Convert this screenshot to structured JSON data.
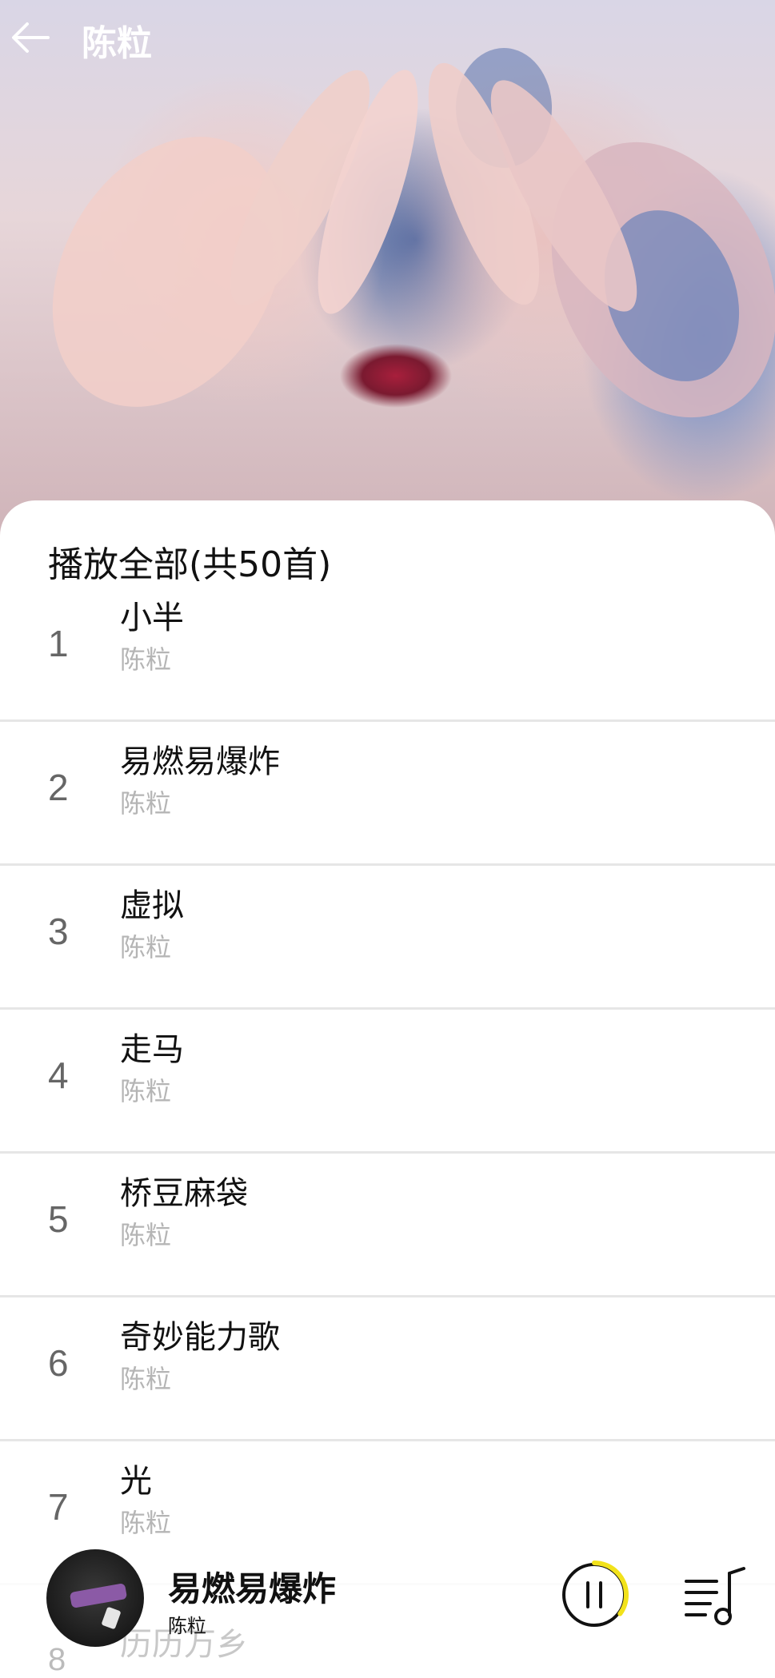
{
  "header": {
    "title": "陈粒"
  },
  "list": {
    "play_all_label": "播放全部(共50首)",
    "songs": [
      {
        "index": "1",
        "name": "小半",
        "artist": "陈粒"
      },
      {
        "index": "2",
        "name": "易燃易爆炸",
        "artist": "陈粒"
      },
      {
        "index": "3",
        "name": "虚拟",
        "artist": "陈粒"
      },
      {
        "index": "4",
        "name": "走马",
        "artist": "陈粒"
      },
      {
        "index": "5",
        "name": "桥豆麻袋",
        "artist": "陈粒"
      },
      {
        "index": "6",
        "name": "奇妙能力歌",
        "artist": "陈粒"
      },
      {
        "index": "7",
        "name": "光",
        "artist": "陈粒"
      }
    ],
    "next_song_partial": "历历万乡",
    "next_index_partial": "8"
  },
  "player": {
    "title": "易燃易爆炸",
    "artist": "陈粒",
    "progress_fraction": 0.35,
    "state": "playing"
  },
  "colors": {
    "accent_progress": "#f2e21b",
    "text_primary": "#111111",
    "text_secondary": "#b5b5b5"
  },
  "icons": {
    "back": "arrow-left-icon",
    "pause": "pause-icon",
    "queue": "playlist-icon"
  }
}
